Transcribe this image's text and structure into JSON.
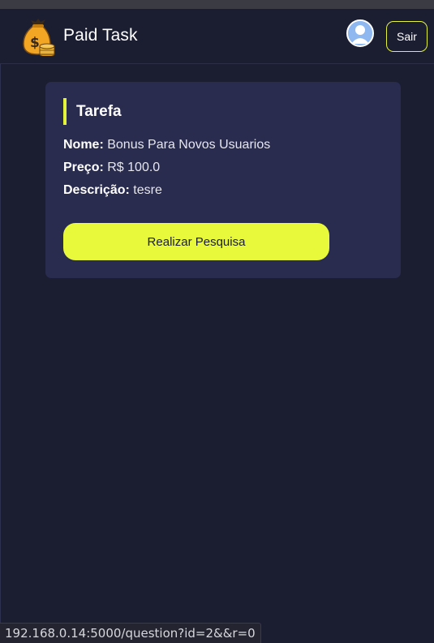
{
  "header": {
    "brand": "Paid Task",
    "logout_label": "Sair"
  },
  "task": {
    "title": "Tarefa",
    "name_label": "Nome:",
    "name_value": "Bonus Para Novos Usuarios",
    "price_label": "Preço:",
    "price_value": "R$ 100.0",
    "description_label": "Descrição:",
    "description_value": "tesre",
    "action_label": "Realizar Pesquisa"
  },
  "status_bar": {
    "url": "192.168.0.14:5000/question?id=2&&r=0"
  },
  "colors": {
    "background": "#1b1d31",
    "card": "#292b4f",
    "accent": "#e8f83a"
  },
  "icons": {
    "logo": "money-bag-icon",
    "avatar": "user-avatar-icon"
  }
}
